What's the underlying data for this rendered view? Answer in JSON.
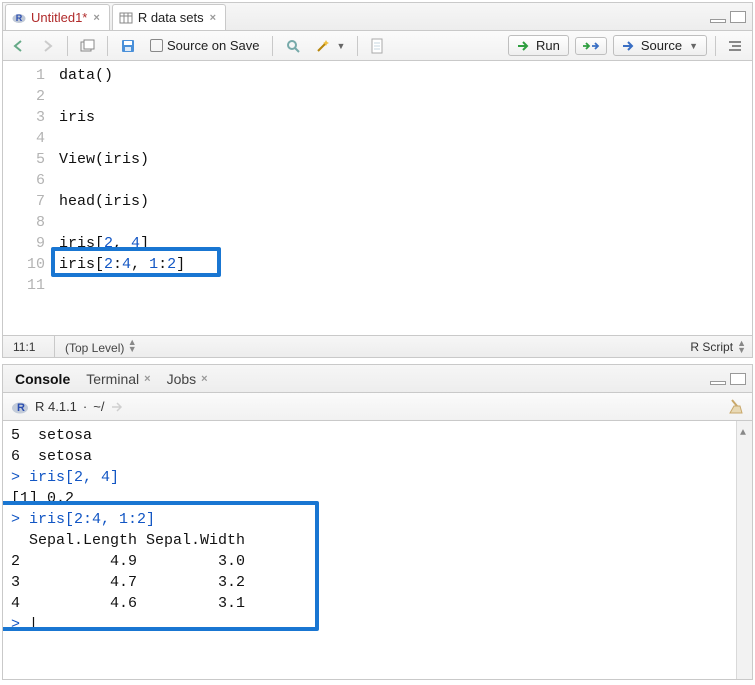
{
  "source": {
    "tabs": [
      {
        "icon": "r-file",
        "label": "Untitled1*",
        "dirty": true
      },
      {
        "icon": "table",
        "label": "R data sets",
        "dirty": false
      }
    ],
    "toolbar": {
      "source_on_save": "Source on Save",
      "run": "Run",
      "source": "Source"
    },
    "lines": [
      "data()",
      "",
      "iris",
      "",
      "View(iris)",
      "",
      "head(iris)",
      "",
      "iris[2, 4]",
      "iris[2:4, 1:2]",
      ""
    ],
    "status": {
      "cursor": "11:1",
      "scope": "(Top Level)",
      "lang": "R Script"
    }
  },
  "console": {
    "tabs": [
      "Console",
      "Terminal",
      "Jobs"
    ],
    "header": {
      "version": "R 4.1.1",
      "path": "~/"
    },
    "output": [
      {
        "t": "out",
        "text": "5  setosa"
      },
      {
        "t": "out",
        "text": "6  setosa"
      },
      {
        "t": "in",
        "text": "iris[2, 4]"
      },
      {
        "t": "out",
        "text": "[1] 0.2"
      },
      {
        "t": "in",
        "text": "iris[2:4, 1:2]"
      },
      {
        "t": "out",
        "text": "  Sepal.Length Sepal.Width"
      },
      {
        "t": "out",
        "text": "2          4.9         3.0"
      },
      {
        "t": "out",
        "text": "3          4.7         3.2"
      },
      {
        "t": "out",
        "text": "4          4.6         3.1"
      },
      {
        "t": "prompt",
        "text": ""
      }
    ]
  }
}
